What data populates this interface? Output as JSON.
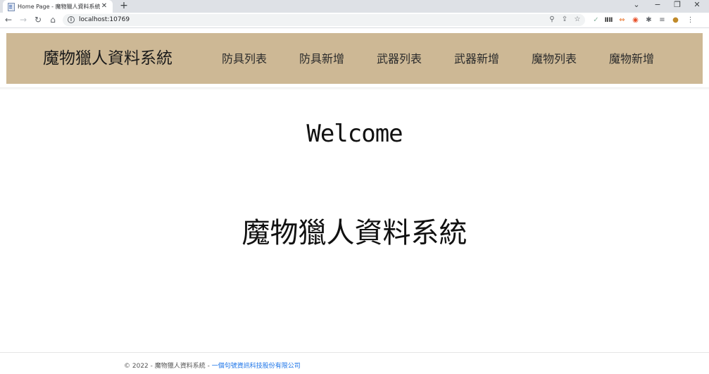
{
  "browser": {
    "tab_title": "Home Page - 魔物獵人資料系統",
    "tab_close": "✕",
    "new_tab": "+",
    "url": "localhost:10769",
    "window_controls": {
      "menu": "⌄",
      "minimize": "−",
      "restore": "❐",
      "close": "✕"
    }
  },
  "navbar": {
    "brand": "魔物獵人資料系統",
    "items": [
      {
        "label": "防具列表"
      },
      {
        "label": "防具新增"
      },
      {
        "label": "武器列表"
      },
      {
        "label": "武器新增"
      },
      {
        "label": "魔物列表"
      },
      {
        "label": "魔物新增"
      }
    ]
  },
  "main": {
    "welcome": "Welcome",
    "title": "魔物獵人資料系統"
  },
  "footer": {
    "prefix": "© 2022 - 魔物獵人資料系統 - ",
    "link": "一個句號資訊科技股份有限公司"
  },
  "colors": {
    "navbar_bg": "#cdb895",
    "link": "#1a73e8"
  }
}
